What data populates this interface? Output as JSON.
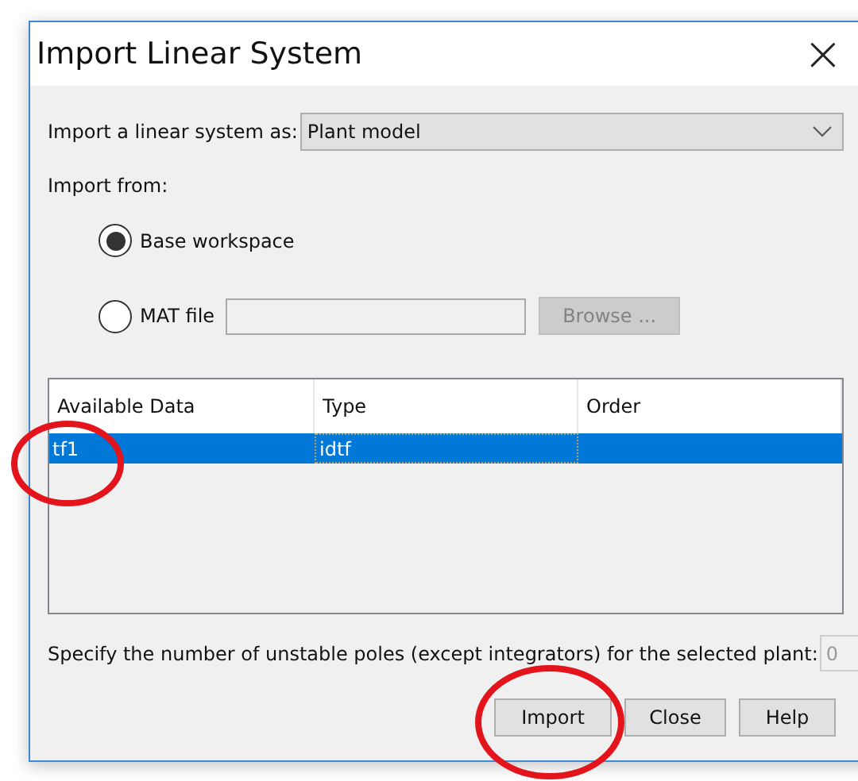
{
  "window": {
    "title": "Import Linear System",
    "close": "×"
  },
  "import_as": {
    "label": "Import a linear system as:",
    "value": "Plant model"
  },
  "import_from": {
    "label": "Import from:",
    "options": [
      {
        "label": "Base workspace",
        "selected": true
      },
      {
        "label": "MAT file",
        "selected": false
      }
    ]
  },
  "mat_file": {
    "browse": "Browse ...",
    "disabled": true
  },
  "table": {
    "columns": [
      "Available Data",
      "Type",
      "Order"
    ],
    "rows": [
      {
        "cells": [
          "tf1",
          "idtf",
          ""
        ],
        "selected": true
      }
    ]
  },
  "unstable_poles": {
    "label": "Specify the number of unstable poles (except integrators) for the selected plant:",
    "value": "0"
  },
  "buttons": [
    "Import",
    "Close",
    "Help"
  ],
  "annotations": [
    {
      "kind": "circle"
    },
    {
      "kind": "circle"
    }
  ]
}
